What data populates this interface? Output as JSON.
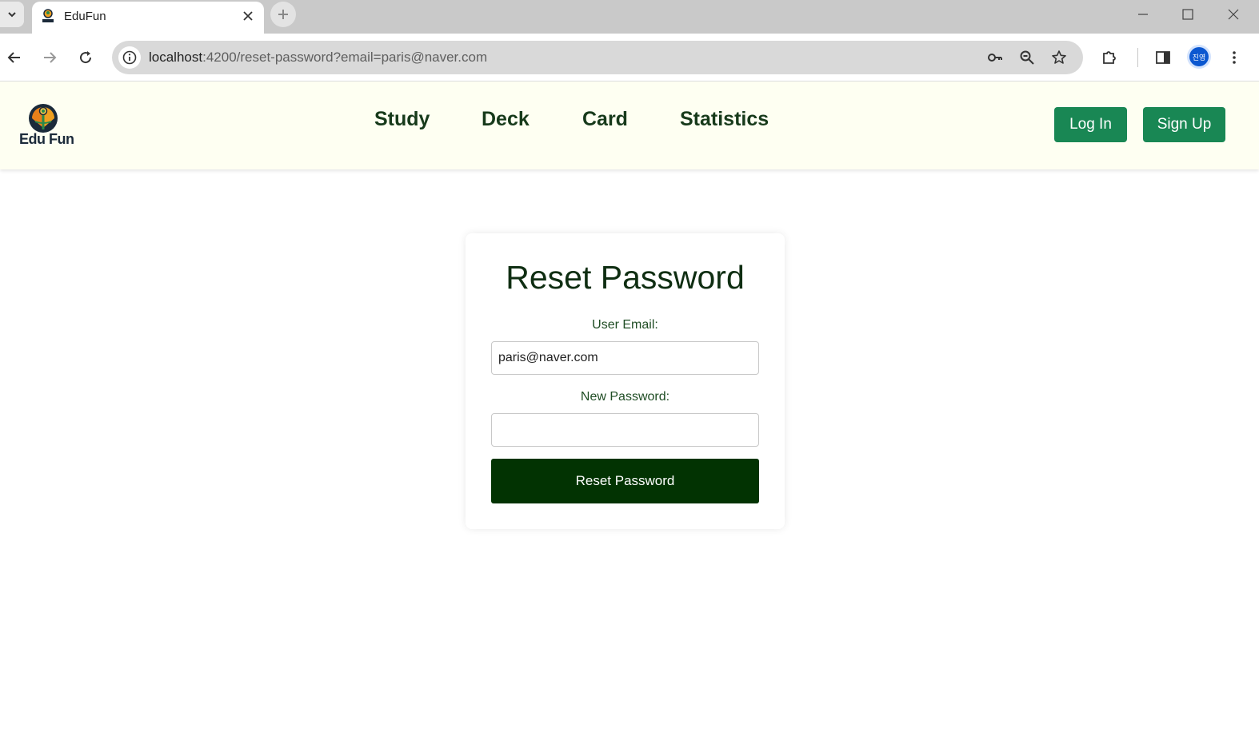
{
  "browser": {
    "tab_title": "EduFun",
    "url_host": "localhost",
    "url_rest": ":4200/reset-password?email=paris@naver.com",
    "profile_initials": "진영"
  },
  "header": {
    "logo_text": "Edu Fun",
    "nav": [
      "Study",
      "Deck",
      "Card",
      "Statistics"
    ],
    "login_label": "Log In",
    "signup_label": "Sign Up",
    "bg_color": "#fefff2",
    "button_color": "#198754"
  },
  "form": {
    "title": "Reset Password",
    "email_label": "User Email:",
    "email_value": "paris@naver.com",
    "password_label": "New Password:",
    "password_value": "",
    "submit_label": "Reset Password",
    "submit_color": "#023302"
  }
}
